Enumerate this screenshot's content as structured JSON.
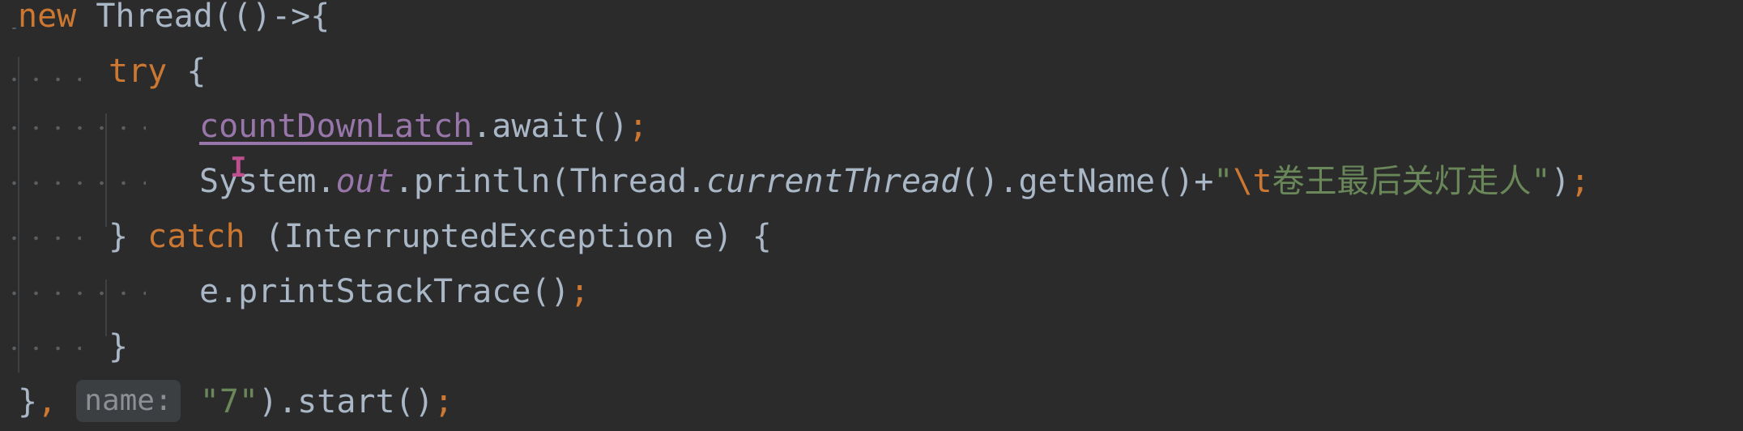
{
  "editor": {
    "lines": [
      {
        "tokens": [
          {
            "text": "new",
            "cls": "kw"
          },
          {
            "text": " Thread(()->{",
            "cls": "punct"
          }
        ]
      },
      {
        "tokens": [
          {
            "text": "try",
            "cls": "kw"
          },
          {
            "text": " {",
            "cls": "punct"
          }
        ]
      },
      {
        "tokens": [
          {
            "text": "countDownLatch",
            "cls": "underline-field"
          },
          {
            "text": ".await()",
            "cls": "punct"
          },
          {
            "text": ";",
            "cls": "semi"
          }
        ]
      },
      {
        "tokens": [
          {
            "text": "System.",
            "cls": "punct"
          },
          {
            "text": "out",
            "cls": "field-italic"
          },
          {
            "text": ".println(Thread.",
            "cls": "punct"
          },
          {
            "text": "currentThread",
            "cls": "italic"
          },
          {
            "text": "().getName()+",
            "cls": "punct"
          },
          {
            "text": "\"",
            "cls": "str"
          },
          {
            "text": "\\t",
            "cls": "esc"
          },
          {
            "text": "卷王最后关灯走人\"",
            "cls": "str"
          },
          {
            "text": ")",
            "cls": "punct"
          },
          {
            "text": ";",
            "cls": "semi"
          }
        ]
      },
      {
        "tokens": [
          {
            "text": "} ",
            "cls": "punct"
          },
          {
            "text": "catch",
            "cls": "kw"
          },
          {
            "text": " (InterruptedException e) {",
            "cls": "punct"
          }
        ]
      },
      {
        "tokens": [
          {
            "text": "e.printStackTrace()",
            "cls": "punct"
          },
          {
            "text": ";",
            "cls": "semi"
          }
        ]
      },
      {
        "tokens": [
          {
            "text": "}",
            "cls": "punct"
          }
        ]
      },
      {
        "tokens": [
          {
            "text": "}",
            "cls": "punct"
          },
          {
            "text": ",",
            "cls": "semi"
          },
          {
            "text": " ",
            "cls": "punct"
          },
          {
            "text": "name:",
            "cls": "hint"
          },
          {
            "text": " ",
            "cls": "punct"
          },
          {
            "text": "\"7\"",
            "cls": "str"
          },
          {
            "text": ").start()",
            "cls": "punct"
          },
          {
            "text": ";",
            "cls": "semi"
          }
        ]
      }
    ],
    "colors": {
      "background": "#2b2b2b",
      "keyword": "#cc7832",
      "field": "#9876aa",
      "string": "#6a8759",
      "default": "#a9b7c6",
      "hint_bg": "#3b3f42"
    }
  }
}
